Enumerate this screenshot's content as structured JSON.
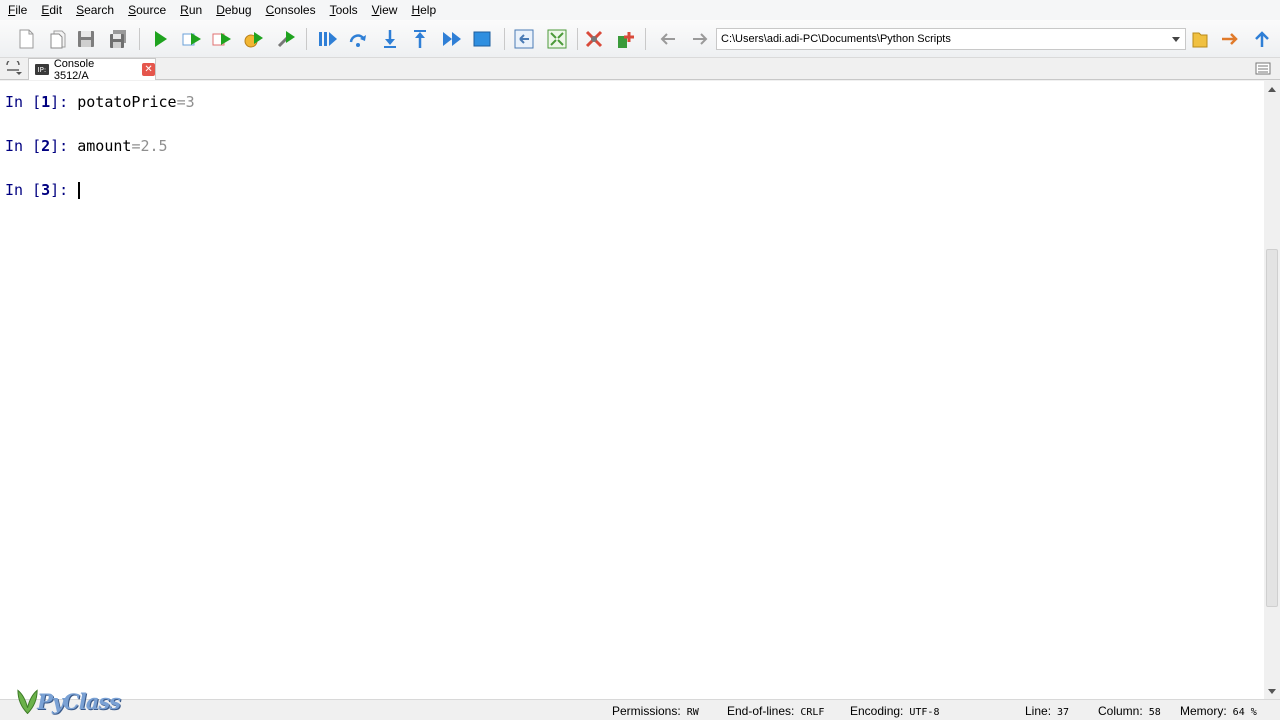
{
  "menu": [
    "File",
    "Edit",
    "Search",
    "Source",
    "Run",
    "Debug",
    "Consoles",
    "Tools",
    "View",
    "Help"
  ],
  "toolbar": {
    "working_directory": "C:\\Users\\adi.adi-PC\\Documents\\Python Scripts",
    "icons": [
      "new-file-icon",
      "open-file-icon",
      "save-icon",
      "save-all-icon",
      "run-icon",
      "run-cell-icon",
      "run-cell-advance-icon",
      "run-selection-icon",
      "configure-run-icon",
      "debug-icon",
      "step-icon",
      "step-into-icon",
      "step-return-icon",
      "continue-icon",
      "stop-debug-icon",
      "maximize-pane-icon",
      "fullscreen-icon",
      "preferences-icon",
      "pythonpath-manager-icon",
      "back-icon",
      "forward-icon",
      "browse-folder-icon",
      "parent-dir-icon"
    ]
  },
  "tabs": [
    {
      "badge": "IP:",
      "label": "Console 3512/A"
    }
  ],
  "console": {
    "lines": [
      {
        "prompt_in": "In [",
        "number": "1",
        "prompt_end": "]:",
        "code": "potatoPrice",
        "op": "=",
        "value": "3"
      },
      {
        "prompt_in": "In [",
        "number": "2",
        "prompt_end": "]:",
        "code": "amount",
        "op": "=",
        "value": "2.5"
      },
      {
        "prompt_in": "In [",
        "number": "3",
        "prompt_end": "]:",
        "code": "",
        "op": "",
        "value": ""
      }
    ]
  },
  "statusbar": {
    "permissions_label": "Permissions:",
    "permissions_value": "RW",
    "eol_label": "End-of-lines:",
    "eol_value": "CRLF",
    "encoding_label": "Encoding:",
    "encoding_value": "UTF-8",
    "line_label": "Line:",
    "line_value": "37",
    "column_label": "Column:",
    "column_value": "58",
    "memory_label": "Memory:",
    "memory_value": "64 %"
  },
  "watermark": {
    "text": "PyClass"
  },
  "colors": {
    "prompt": "#000080",
    "literal": "#8f8f8f",
    "run": "#1fa31f",
    "debug": "#2f7fd6"
  }
}
